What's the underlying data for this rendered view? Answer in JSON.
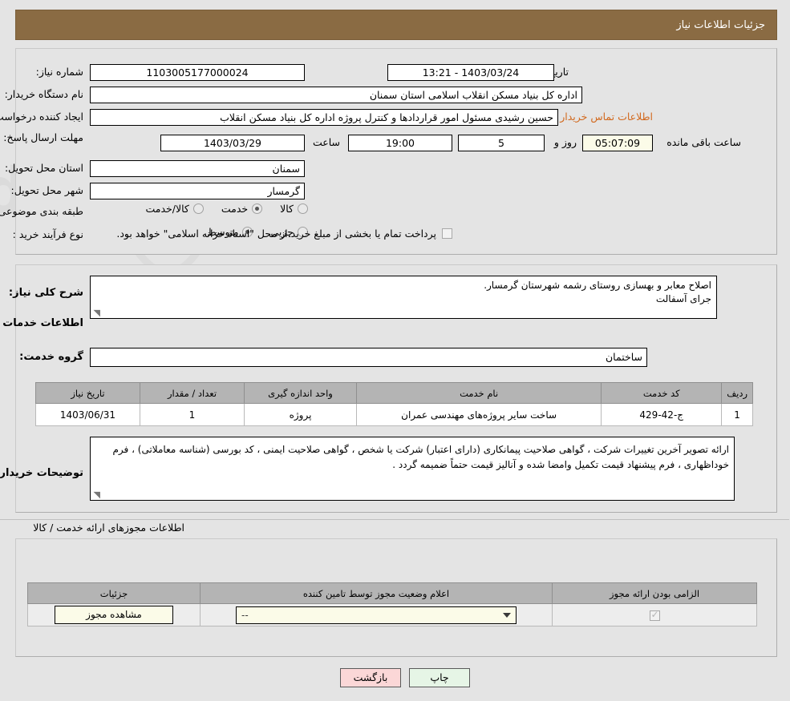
{
  "header": {
    "title": "جزئیات اطلاعات نیاز"
  },
  "top": {
    "need_no_label": "شماره نیاز:",
    "need_no_value": "1103005177000024",
    "announce_label": "تاریخ و ساعت اعلان عمومی:",
    "announce_value": "1403/03/24 - 13:21",
    "buyer_org_label": "نام دستگاه خریدار:",
    "buyer_org_value": "اداره کل بنیاد مسکن انقلاب اسلامی استان سمنان",
    "creator_label": "ایجاد کننده درخواست:",
    "creator_value": "حسین رشیدی مسئول امور قراردادها و کنترل پروژه اداره کل بنیاد مسکن انقلاب",
    "contact_link": "اطلاعات تماس خریدار",
    "deadline_label": "مهلت ارسال پاسخ: تا تاریخ:",
    "deadline_date": "1403/03/29",
    "deadline_hour_label": "ساعت",
    "deadline_hour": "19:00",
    "remain_days": "5",
    "remain_days_label": "روز و",
    "remain_time": "05:07:09",
    "remain_time_label": "ساعت باقی مانده",
    "province_label": "استان محل تحویل:",
    "province_value": "سمنان",
    "city_label": "شهر محل تحویل:",
    "city_value": "گرمسار",
    "category_label": "طبقه بندی موضوعی:",
    "category_options": [
      {
        "label": "کالا",
        "selected": false
      },
      {
        "label": "خدمت",
        "selected": true
      },
      {
        "label": "کالا/خدمت",
        "selected": false
      }
    ],
    "process_label": "نوع فرآیند خرید :",
    "process_options": [
      {
        "label": "جزیی",
        "selected": false
      },
      {
        "label": "متوسط",
        "selected": true
      }
    ],
    "treasury_checked": false,
    "treasury_note": "پرداخت تمام یا بخشی از مبلغ خرید،از محل \"اسناد خزانه اسلامی\" خواهد بود."
  },
  "mid": {
    "summary_label": "شرح کلی نیاز:",
    "summary_value": "اصلاح معابر و بهسازی روستای رشمه شهرستان گرمسار.\nجرای آسفالت",
    "services_heading": "اطلاعات خدمات مورد نیاز",
    "service_group_label": "گروه خدمت:",
    "service_group_value": "ساختمان",
    "table": {
      "columns": [
        "ردیف",
        "کد خدمت",
        "نام خدمت",
        "واحد اندازه گیری",
        "تعداد / مقدار",
        "تاریخ نیاز"
      ],
      "rows": [
        [
          "1",
          "ج-42-429",
          "ساخت سایر پروژه‌های مهندسی عمران",
          "پروژه",
          "1",
          "1403/06/31"
        ]
      ]
    },
    "notes_label": "توضیحات خریدار:",
    "notes_value": "ارائه تصویر آخرین تغییرات شرکت ، گواهی صلاحیت پیمانکاری (دارای اعتبار) شرکت یا شخص ، گواهی صلاحیت ایمنی ، کد بورسی (شناسه معاملاتی) ، فرم خوداظهاری ، فرم پیشنهاد قیمت تکمیل وامضا شده و آنالیز قیمت حتماً ضمیمه گردد ."
  },
  "bottom": {
    "section_label": "اطلاعات مجوزهای ارائه خدمت / کالا",
    "table": {
      "columns": [
        "الزامی بودن ارائه مجوز",
        "اعلام وضعیت مجوز توسط تامین کننده",
        "جزئیات"
      ],
      "rows": [
        {
          "required_checked": true,
          "status_value": "--",
          "details_button": "مشاهده مجوز"
        }
      ]
    }
  },
  "footer": {
    "print_label": "چاپ",
    "back_label": "بازگشت"
  }
}
